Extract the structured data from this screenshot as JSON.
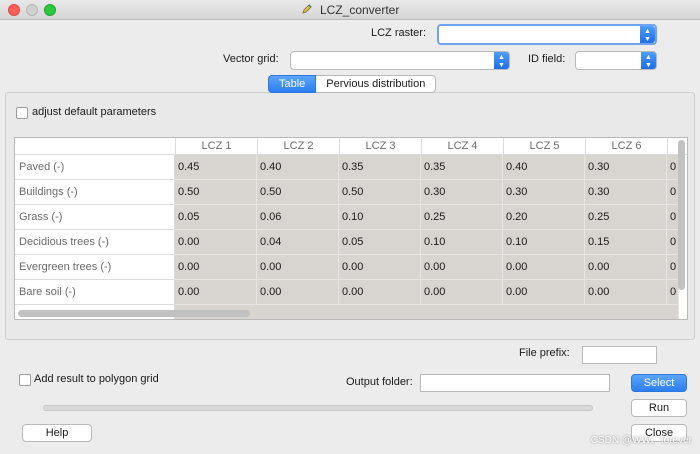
{
  "window": {
    "title": "LCZ_converter"
  },
  "form": {
    "lcz_raster_label": "LCZ raster:",
    "lcz_raster_value": "",
    "vector_grid_label": "Vector grid:",
    "vector_grid_value": "",
    "id_field_label": "ID field:",
    "id_field_value": ""
  },
  "tabs": [
    {
      "label": "Table",
      "active": true
    },
    {
      "label": "Pervious distribution",
      "active": false
    }
  ],
  "adjust_params": {
    "label": "adjust default parameters",
    "checked": false
  },
  "table": {
    "columns": [
      "LCZ 1",
      "LCZ 2",
      "LCZ 3",
      "LCZ 4",
      "LCZ 5",
      "LCZ 6"
    ],
    "rows": [
      {
        "label": "Paved (-)",
        "values": [
          "0.45",
          "0.40",
          "0.35",
          "0.35",
          "0.40",
          "0.30",
          "0"
        ]
      },
      {
        "label": "Buildings (-)",
        "values": [
          "0.50",
          "0.50",
          "0.50",
          "0.30",
          "0.30",
          "0.30",
          "0"
        ]
      },
      {
        "label": "Grass (-)",
        "values": [
          "0.05",
          "0.06",
          "0.10",
          "0.25",
          "0.20",
          "0.25",
          "0"
        ]
      },
      {
        "label": "Decidious trees (-)",
        "values": [
          "0.00",
          "0.04",
          "0.05",
          "0.10",
          "0.10",
          "0.15",
          "0"
        ]
      },
      {
        "label": "Evergreen trees (-)",
        "values": [
          "0.00",
          "0.00",
          "0.00",
          "0.00",
          "0.00",
          "0.00",
          "0"
        ]
      },
      {
        "label": "Bare soil (-)",
        "values": [
          "0.00",
          "0.00",
          "0.00",
          "0.00",
          "0.00",
          "0.00",
          "0"
        ]
      }
    ]
  },
  "output": {
    "file_prefix_label": "File prefix:",
    "file_prefix_value": "",
    "add_result_label": "Add result to polygon grid",
    "add_result_checked": false,
    "output_folder_label": "Output folder:",
    "output_folder_value": "",
    "select_label": "Select",
    "run_label": "Run",
    "help_label": "Help",
    "close_label": "Close",
    "progress": 0
  },
  "watermark": "CSDN @WW、forever"
}
